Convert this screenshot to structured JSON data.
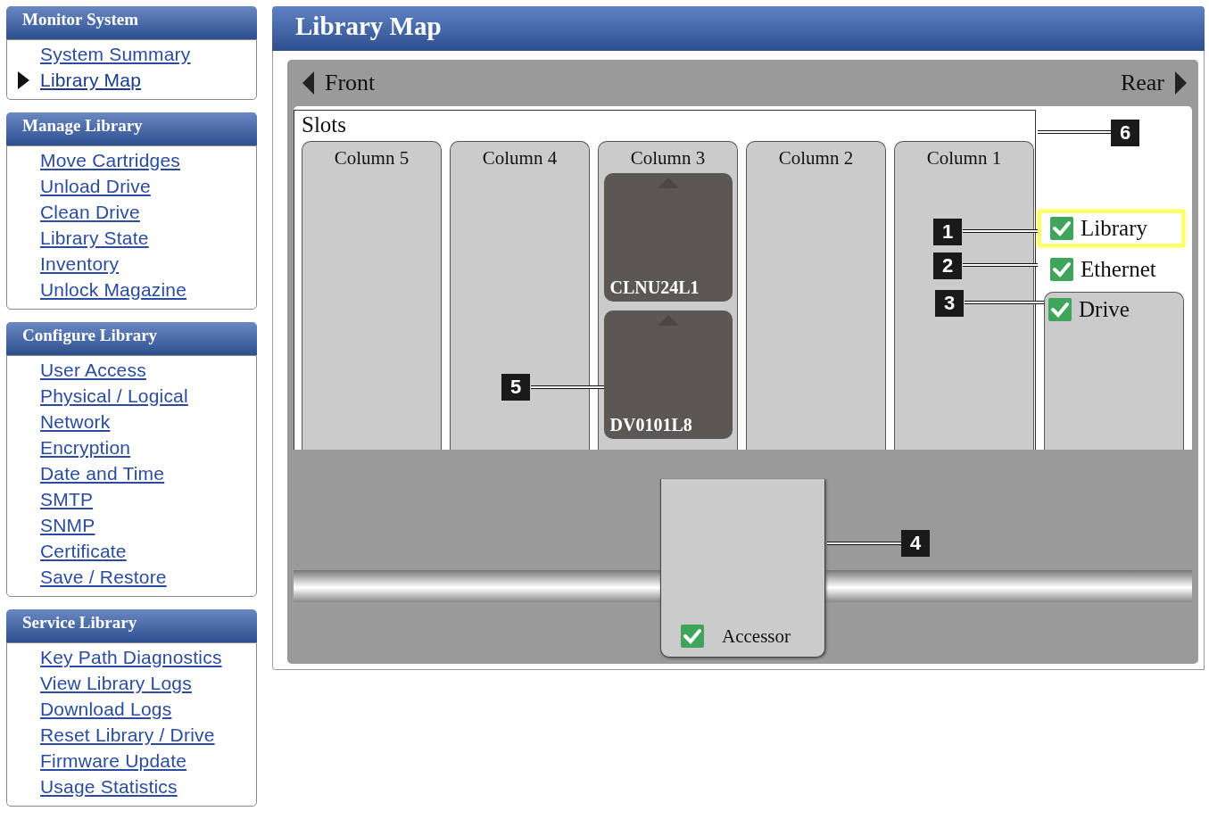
{
  "sidebar": {
    "sections": [
      {
        "title": "Monitor System",
        "items": [
          {
            "label": "System Summary",
            "selected": false
          },
          {
            "label": "Library Map",
            "selected": true
          }
        ]
      },
      {
        "title": "Manage Library",
        "items": [
          {
            "label": "Move Cartridges",
            "selected": false
          },
          {
            "label": "Unload Drive",
            "selected": false
          },
          {
            "label": "Clean Drive",
            "selected": false
          },
          {
            "label": "Library State",
            "selected": false
          },
          {
            "label": "Inventory",
            "selected": false
          },
          {
            "label": "Unlock Magazine",
            "selected": false
          }
        ]
      },
      {
        "title": "Configure Library",
        "items": [
          {
            "label": "User Access",
            "selected": false
          },
          {
            "label": "Physical / Logical",
            "selected": false
          },
          {
            "label": "Network",
            "selected": false
          },
          {
            "label": "Encryption",
            "selected": false
          },
          {
            "label": "Date and Time",
            "selected": false
          },
          {
            "label": "SMTP",
            "selected": false
          },
          {
            "label": "SNMP",
            "selected": false
          },
          {
            "label": "Certificate",
            "selected": false
          },
          {
            "label": "Save / Restore",
            "selected": false
          }
        ]
      },
      {
        "title": "Service Library",
        "items": [
          {
            "label": "Key Path Diagnostics",
            "selected": false
          },
          {
            "label": "View Library Logs",
            "selected": false
          },
          {
            "label": "Download Logs",
            "selected": false
          },
          {
            "label": "Reset Library / Drive",
            "selected": false
          },
          {
            "label": "Firmware Update",
            "selected": false
          },
          {
            "label": "Usage Statistics",
            "selected": false
          }
        ]
      }
    ]
  },
  "page": {
    "title": "Library Map"
  },
  "map": {
    "front_label": "Front",
    "rear_label": "Rear",
    "slots_label": "Slots",
    "columns": [
      {
        "name": "Column 5"
      },
      {
        "name": "Column 4"
      },
      {
        "name": "Column 3",
        "cartridges": [
          "CLNU24L1",
          "DV0101L8"
        ]
      },
      {
        "name": "Column 2"
      },
      {
        "name": "Column 1"
      }
    ],
    "status": [
      {
        "label": "Library",
        "checked": true,
        "highlighted": true
      },
      {
        "label": "Ethernet",
        "checked": true,
        "highlighted": false
      }
    ],
    "drive": {
      "label": "Drive",
      "checked": true
    },
    "accessor": {
      "label": "Accessor",
      "checked": true
    },
    "callouts": [
      "1",
      "2",
      "3",
      "4",
      "5",
      "6"
    ]
  }
}
